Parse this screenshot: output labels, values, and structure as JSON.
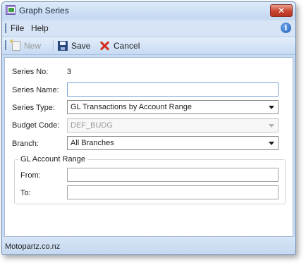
{
  "window": {
    "title": "Graph Series",
    "close_label": "✕"
  },
  "menu": {
    "items": [
      "File",
      "Help"
    ],
    "info_glyph": "i"
  },
  "toolbar": {
    "new_label": "New",
    "save_label": "Save",
    "cancel_label": "Cancel"
  },
  "form": {
    "series_no_label": "Series No:",
    "series_no_value": "3",
    "series_name_label": "Series Name:",
    "series_name_value": "",
    "series_type_label": "Series Type:",
    "series_type_value": "GL Transactions by Account Range",
    "budget_code_label": "Budget Code:",
    "budget_code_value": "DEF_BUDG",
    "branch_label": "Branch:",
    "branch_value": "All Branches",
    "gl_group_title": "GL Account Range",
    "from_label": "From:",
    "from_value": "",
    "to_label": "To:",
    "to_value": ""
  },
  "status": {
    "text": "Motopartz.co.nz"
  },
  "icons": {
    "app": "graph-app-icon",
    "close": "close-icon",
    "info": "info-icon",
    "new": "new-document-icon",
    "save": "floppy-disk-icon",
    "cancel": "red-x-icon"
  }
}
